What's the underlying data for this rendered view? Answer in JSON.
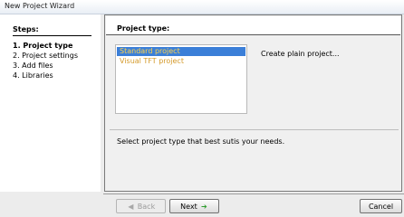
{
  "window": {
    "title": "New Project Wizard"
  },
  "steps": {
    "title": "Steps:",
    "items": [
      "1. Project type",
      "2. Project settings",
      "3. Add files",
      "4. Libraries"
    ],
    "active_index": 0
  },
  "main": {
    "header": "Project type:",
    "list": {
      "items": [
        "Standard project",
        "Visual TFT project"
      ],
      "selected_index": 0
    },
    "selected_description": "Create plain project...",
    "info": "Select project type that best sutis your needs."
  },
  "footer": {
    "back_label": "Back",
    "next_label": "Next",
    "cancel_label": "Cancel",
    "back_icon": "arrow-left-icon",
    "next_icon": "arrow-right-icon"
  },
  "colors": {
    "selection_bg": "#3b7fd8",
    "selection_text": "#ffd24a",
    "item_text": "#d49a2b",
    "next_arrow": "#2f9d2f"
  }
}
